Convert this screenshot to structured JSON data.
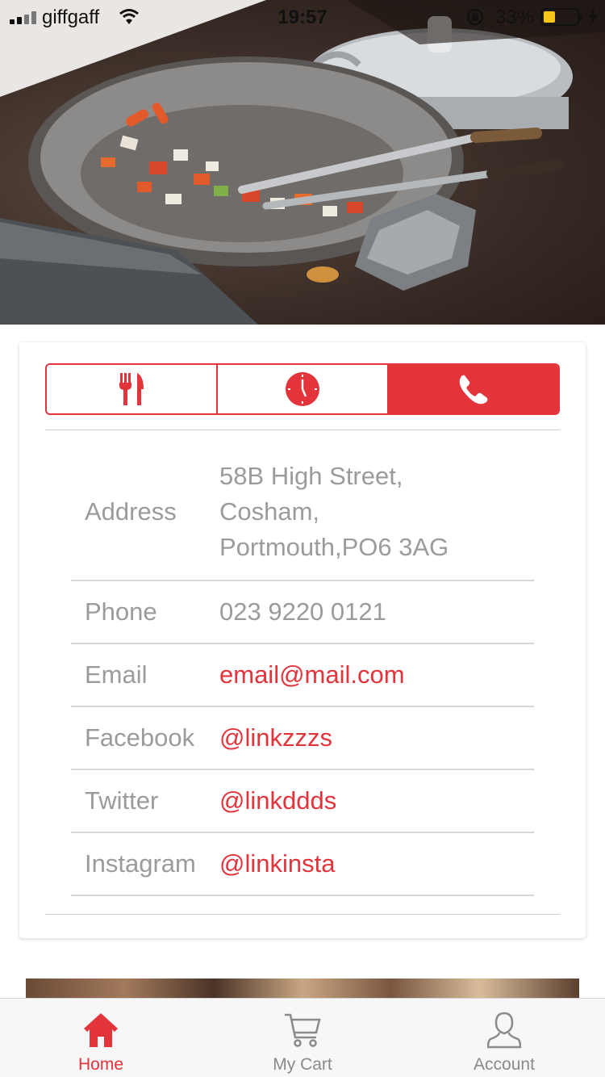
{
  "status_bar": {
    "carrier": "giffgaff",
    "time": "19:57",
    "battery_percent": "33%"
  },
  "hero": {
    "image_icon": "wok-cooking-photo"
  },
  "tabs": [
    {
      "icon": "fork-knife-icon",
      "active": false
    },
    {
      "icon": "clock-icon",
      "active": false
    },
    {
      "icon": "phone-icon",
      "active": true
    }
  ],
  "contact": {
    "address_label": "Address",
    "address_lines": [
      "58B High Street,",
      "Cosham,",
      "Portmouth,PO6 3AG"
    ],
    "phone_label": "Phone",
    "phone_value": "023 9220 0121",
    "email_label": "Email",
    "email_value": "email@mail.com",
    "facebook_label": "Facebook",
    "facebook_value": "@linkzzzs",
    "twitter_label": "Twitter",
    "twitter_value": "@linkddds",
    "instagram_label": "Instagram",
    "instagram_value": "@linkinsta"
  },
  "nav": {
    "home_label": "Home",
    "cart_label": "My Cart",
    "account_label": "Account"
  },
  "colors": {
    "accent": "#e3333b",
    "muted_text": "#9b9b9b"
  }
}
